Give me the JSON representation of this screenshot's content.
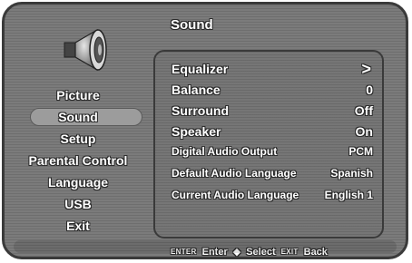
{
  "screen": {
    "title": "Sound"
  },
  "menu": {
    "items": [
      {
        "label": "Picture",
        "selected": false
      },
      {
        "label": "Sound",
        "selected": true
      },
      {
        "label": "Setup",
        "selected": false
      },
      {
        "label": "Parental Control",
        "selected": false
      },
      {
        "label": "Language",
        "selected": false
      },
      {
        "label": "USB",
        "selected": false
      },
      {
        "label": "Exit",
        "selected": false
      }
    ]
  },
  "settings": [
    {
      "label": "Equalizer",
      "value": ">"
    },
    {
      "label": "Balance",
      "value": "0"
    },
    {
      "label": "Surround",
      "value": "Off"
    },
    {
      "label": "Speaker",
      "value": "On"
    },
    {
      "label": "Digital Audio Output",
      "value": "PCM"
    },
    {
      "label": "Default Audio Language",
      "value": "Spanish"
    },
    {
      "label": "Current Audio Language",
      "value": "English 1"
    }
  ],
  "footer": {
    "enter_key": "ENTER",
    "enter_label": "Enter",
    "select_label": "Select",
    "exit_key": "EXIT",
    "back_label": "Back"
  },
  "icons": {
    "speaker": "speaker-icon",
    "navigate": "diamond-updown-icon"
  }
}
